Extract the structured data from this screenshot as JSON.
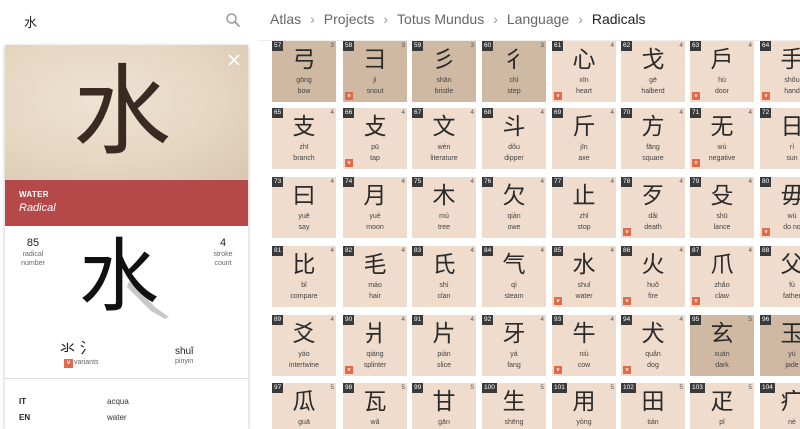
{
  "search": {
    "value": "水"
  },
  "breadcrumb": [
    "Atlas",
    "Projects",
    "Totus Mundus",
    "Language",
    "Radicals"
  ],
  "detail": {
    "hero_char": "水",
    "name": "WATER",
    "subtitle": "Radical",
    "radical_number": "85",
    "radical_number_label": "radical\nnumber",
    "stroke_count": "4",
    "stroke_count_label": "stroke\ncount",
    "big_char": "水",
    "variant_chars": "氺 氵",
    "variants_label": "variants",
    "variant_badge": "v",
    "pinyin": "shuǐ",
    "pinyin_label": "pinyin",
    "translations": [
      {
        "lang": "IT",
        "value": "acqua"
      },
      {
        "lang": "EN",
        "value": "water"
      }
    ]
  },
  "colors": {
    "accent": "#b54848",
    "variant_badge": "#e06a4a",
    "tile": "#efdccd",
    "tile_dark": "#cfb9a2"
  },
  "tiles": [
    [
      {
        "num": "57",
        "strokes": "3",
        "char": "弓",
        "pinyin": "gōng",
        "meaning": "bow",
        "v": false,
        "dark": true
      },
      {
        "num": "58",
        "strokes": "3",
        "char": "彐",
        "pinyin": "jì",
        "meaning": "snout",
        "v": true,
        "dark": true
      },
      {
        "num": "59",
        "strokes": "3",
        "char": "彡",
        "pinyin": "shān",
        "meaning": "bristle",
        "v": false,
        "dark": true
      },
      {
        "num": "60",
        "strokes": "3",
        "char": "彳",
        "pinyin": "chì",
        "meaning": "step",
        "v": false,
        "dark": true
      },
      {
        "num": "61",
        "strokes": "4",
        "char": "心",
        "pinyin": "xīn",
        "meaning": "heart",
        "v": true,
        "dark": false
      },
      {
        "num": "62",
        "strokes": "4",
        "char": "戈",
        "pinyin": "gē",
        "meaning": "halberd",
        "v": false,
        "dark": false
      },
      {
        "num": "63",
        "strokes": "4",
        "char": "戶",
        "pinyin": "hù",
        "meaning": "door",
        "v": true,
        "dark": false
      },
      {
        "num": "64",
        "strokes": "4",
        "char": "手",
        "pinyin": "shǒu",
        "meaning": "hand",
        "v": true,
        "dark": false
      }
    ],
    [
      {
        "num": "65",
        "strokes": "4",
        "char": "支",
        "pinyin": "zhī",
        "meaning": "branch",
        "v": false,
        "dark": false
      },
      {
        "num": "66",
        "strokes": "4",
        "char": "攴",
        "pinyin": "pū",
        "meaning": "tap",
        "v": true,
        "dark": false
      },
      {
        "num": "67",
        "strokes": "4",
        "char": "文",
        "pinyin": "wén",
        "meaning": "literature",
        "v": false,
        "dark": false
      },
      {
        "num": "68",
        "strokes": "4",
        "char": "斗",
        "pinyin": "dǒu",
        "meaning": "dipper",
        "v": false,
        "dark": false
      },
      {
        "num": "69",
        "strokes": "4",
        "char": "斤",
        "pinyin": "jīn",
        "meaning": "axe",
        "v": false,
        "dark": false
      },
      {
        "num": "70",
        "strokes": "4",
        "char": "方",
        "pinyin": "fāng",
        "meaning": "square",
        "v": false,
        "dark": false
      },
      {
        "num": "71",
        "strokes": "4",
        "char": "无",
        "pinyin": "wú",
        "meaning": "negative",
        "v": true,
        "dark": false
      },
      {
        "num": "72",
        "strokes": "4",
        "char": "日",
        "pinyin": "rì",
        "meaning": "sun",
        "v": false,
        "dark": false
      }
    ],
    [
      {
        "num": "73",
        "strokes": "4",
        "char": "曰",
        "pinyin": "yuē",
        "meaning": "say",
        "v": false,
        "dark": false
      },
      {
        "num": "74",
        "strokes": "4",
        "char": "月",
        "pinyin": "yuè",
        "meaning": "moon",
        "v": false,
        "dark": false
      },
      {
        "num": "75",
        "strokes": "4",
        "char": "木",
        "pinyin": "mù",
        "meaning": "tree",
        "v": false,
        "dark": false
      },
      {
        "num": "76",
        "strokes": "4",
        "char": "欠",
        "pinyin": "qiàn",
        "meaning": "owe",
        "v": false,
        "dark": false
      },
      {
        "num": "77",
        "strokes": "4",
        "char": "止",
        "pinyin": "zhǐ",
        "meaning": "stop",
        "v": false,
        "dark": false
      },
      {
        "num": "78",
        "strokes": "4",
        "char": "歹",
        "pinyin": "dǎi",
        "meaning": "death",
        "v": true,
        "dark": false
      },
      {
        "num": "79",
        "strokes": "4",
        "char": "殳",
        "pinyin": "shū",
        "meaning": "lance",
        "v": false,
        "dark": false
      },
      {
        "num": "80",
        "strokes": "4",
        "char": "毋",
        "pinyin": "wú",
        "meaning": "do no",
        "v": true,
        "dark": false
      }
    ],
    [
      {
        "num": "81",
        "strokes": "4",
        "char": "比",
        "pinyin": "bǐ",
        "meaning": "compare",
        "v": false,
        "dark": false
      },
      {
        "num": "82",
        "strokes": "4",
        "char": "毛",
        "pinyin": "máo",
        "meaning": "hair",
        "v": false,
        "dark": false
      },
      {
        "num": "83",
        "strokes": "4",
        "char": "氏",
        "pinyin": "shì",
        "meaning": "clan",
        "v": false,
        "dark": false
      },
      {
        "num": "84",
        "strokes": "4",
        "char": "气",
        "pinyin": "qì",
        "meaning": "steam",
        "v": false,
        "dark": false
      },
      {
        "num": "85",
        "strokes": "4",
        "char": "水",
        "pinyin": "shuǐ",
        "meaning": "water",
        "v": true,
        "dark": false
      },
      {
        "num": "86",
        "strokes": "4",
        "char": "火",
        "pinyin": "huǒ",
        "meaning": "fire",
        "v": true,
        "dark": false
      },
      {
        "num": "87",
        "strokes": "4",
        "char": "爪",
        "pinyin": "zhǎo",
        "meaning": "claw",
        "v": true,
        "dark": false
      },
      {
        "num": "88",
        "strokes": "4",
        "char": "父",
        "pinyin": "fù",
        "meaning": "father",
        "v": false,
        "dark": false
      }
    ],
    [
      {
        "num": "89",
        "strokes": "4",
        "char": "爻",
        "pinyin": "yáo",
        "meaning": "intertwine",
        "v": false,
        "dark": false
      },
      {
        "num": "90",
        "strokes": "4",
        "char": "爿",
        "pinyin": "qiáng",
        "meaning": "splinter",
        "v": true,
        "dark": false
      },
      {
        "num": "91",
        "strokes": "4",
        "char": "片",
        "pinyin": "piàn",
        "meaning": "slice",
        "v": false,
        "dark": false
      },
      {
        "num": "92",
        "strokes": "4",
        "char": "牙",
        "pinyin": "yá",
        "meaning": "fang",
        "v": false,
        "dark": false
      },
      {
        "num": "93",
        "strokes": "4",
        "char": "牛",
        "pinyin": "niú",
        "meaning": "cow",
        "v": true,
        "dark": false
      },
      {
        "num": "94",
        "strokes": "4",
        "char": "犬",
        "pinyin": "quǎn",
        "meaning": "dog",
        "v": true,
        "dark": false
      },
      {
        "num": "95",
        "strokes": "5",
        "char": "玄",
        "pinyin": "xuán",
        "meaning": "dark",
        "v": false,
        "dark": true
      },
      {
        "num": "96",
        "strokes": "5",
        "char": "玉",
        "pinyin": "yù",
        "meaning": "jade",
        "v": false,
        "dark": true
      }
    ],
    [
      {
        "num": "97",
        "strokes": "5",
        "char": "瓜",
        "pinyin": "guā",
        "meaning": "",
        "v": false,
        "dark": false
      },
      {
        "num": "98",
        "strokes": "5",
        "char": "瓦",
        "pinyin": "wǎ",
        "meaning": "",
        "v": false,
        "dark": false
      },
      {
        "num": "99",
        "strokes": "5",
        "char": "甘",
        "pinyin": "gān",
        "meaning": "",
        "v": false,
        "dark": false
      },
      {
        "num": "100",
        "strokes": "5",
        "char": "生",
        "pinyin": "shēng",
        "meaning": "",
        "v": false,
        "dark": false
      },
      {
        "num": "101",
        "strokes": "5",
        "char": "用",
        "pinyin": "yòng",
        "meaning": "",
        "v": false,
        "dark": false
      },
      {
        "num": "102",
        "strokes": "5",
        "char": "田",
        "pinyin": "tián",
        "meaning": "",
        "v": false,
        "dark": false
      },
      {
        "num": "103",
        "strokes": "5",
        "char": "疋",
        "pinyin": "pǐ",
        "meaning": "",
        "v": false,
        "dark": false
      },
      {
        "num": "104",
        "strokes": "5",
        "char": "疒",
        "pinyin": "nè",
        "meaning": "",
        "v": false,
        "dark": false
      }
    ]
  ]
}
